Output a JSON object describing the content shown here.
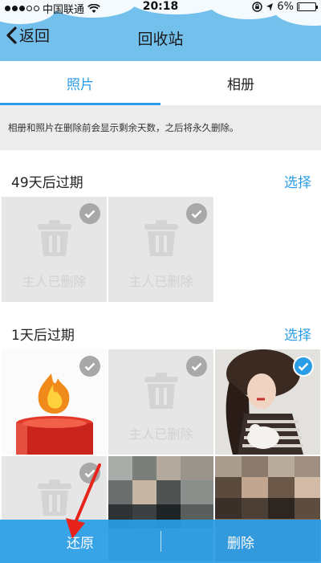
{
  "status_bar": {
    "carrier": "中国联通",
    "time": "20:18",
    "battery": "6%",
    "battery_level": 0.06
  },
  "nav": {
    "back_label": "返回",
    "title": "回收站"
  },
  "tabs": [
    {
      "label": "照片",
      "active": true
    },
    {
      "label": "相册",
      "active": false
    }
  ],
  "notice": "相册和照片在删除前会显示剩余天数，之后将永久删除。",
  "sections": [
    {
      "title": "49天后过期",
      "select_label": "选择",
      "items": [
        {
          "type": "deleted",
          "label": "主人已删除",
          "checked": false
        },
        {
          "type": "deleted",
          "label": "主人已删除",
          "checked": false
        }
      ]
    },
    {
      "title": "1天后过期",
      "select_label": "选择",
      "items": [
        {
          "type": "photo",
          "subject": "candle",
          "checked": false
        },
        {
          "type": "deleted",
          "label": "主人已删除",
          "checked": false
        },
        {
          "type": "photo",
          "subject": "girl-with-cat",
          "checked": true
        },
        {
          "type": "deleted",
          "label": "",
          "checked": false
        },
        {
          "type": "photo",
          "subject": "pixelated",
          "checked": false
        },
        {
          "type": "photo",
          "subject": "pixelated",
          "checked": false
        }
      ]
    }
  ],
  "bottom_bar": {
    "restore_label": "还原",
    "delete_label": "删除"
  },
  "colors": {
    "accent": "#2b9de6",
    "header_bg": "#73c0ec",
    "deleted_bg": "#e6e6e6"
  },
  "icons": [
    "back-chevron-icon",
    "wifi-icon",
    "battery-icon",
    "lock-rotation-icon",
    "location-icon",
    "trash-icon",
    "check-icon",
    "red-arrow-annotation"
  ]
}
